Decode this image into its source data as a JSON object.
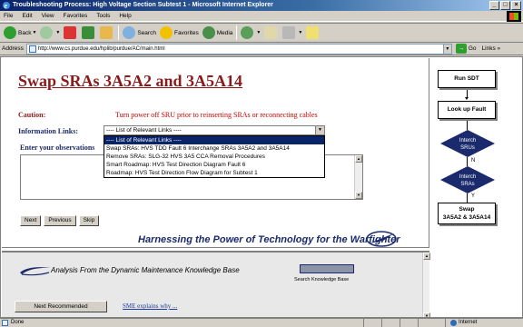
{
  "window": {
    "title": "Troubleshooting Process: High Voltage Section Subtest 1 - Microsoft Internet Explorer",
    "min": "_",
    "max": "□",
    "close": "×"
  },
  "menu": [
    "File",
    "Edit",
    "View",
    "Favorites",
    "Tools",
    "Help"
  ],
  "toolbar": {
    "back": "Back",
    "search": "Search",
    "favorites": "Favorites",
    "media": "Media"
  },
  "address": {
    "label": "Address",
    "url": "http://www.cs.purdue.edu/hplib/purdue/AC/main.html",
    "go": "Go",
    "links": "Links »"
  },
  "main": {
    "title": "Swap SRAs 3A5A2 and 3A5A14",
    "caution_label": "Caution:",
    "caution_text": "Turn power off SRU prior to reinserting SRAs or reconnecting cables",
    "info_label": "Information Links:",
    "select_value": "---- List of Relevant Links ----",
    "dropdown_options": [
      "---- List of Relevant Links ----",
      "Swap SRAs: HVS TDD Fault 6 Interchange SRAs 3A5A2 and 3A5A14",
      "Remove SRAs: SLG-32 HVS 3A5 CCA Removal Procedures",
      "Smart Roadmap: HVS Test Direction Diagram Fault 6",
      "Roadmap: HVS Test Direction Flow Diagram for Subtest 1"
    ],
    "obs_label": "Enter your observations",
    "buttons": {
      "next": "Next",
      "previous": "Previous",
      "skip": "Skip"
    },
    "slogan": "Harnessing the Power of Technology for the Warfighter"
  },
  "bottom": {
    "kb_text": "Analysis From the  Dynamic Maintenance Knowledge Base",
    "search_label": "Search Knowledge Base",
    "next_recommended": "Next Recommended",
    "sme_link": "SME explains why ..."
  },
  "flow": {
    "run_sdt": "Run SDT",
    "look_up_fault": "Look up Fault",
    "interch_srus": [
      "Interch",
      "SRUs"
    ],
    "branch_n": "N",
    "interch_sras": [
      "Interch",
      "SRAs"
    ],
    "branch_y": "Y",
    "swap": [
      "Swap",
      "3A5A2 & 3A5A14"
    ],
    "diamond_color": "#1a2a6c"
  },
  "status": {
    "done": "Done",
    "zone": "Internet"
  }
}
